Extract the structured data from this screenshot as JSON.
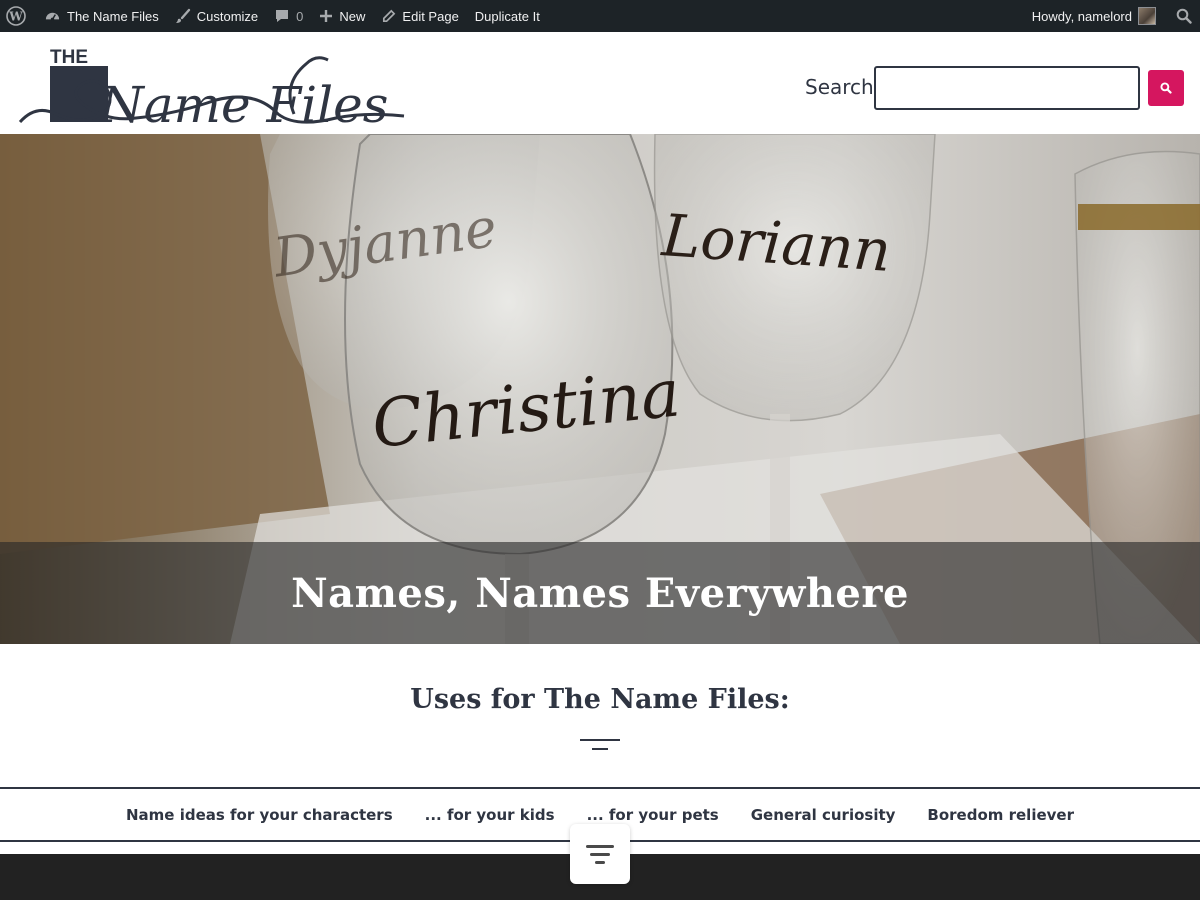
{
  "adminbar": {
    "site_name": "The Name Files",
    "customize": "Customize",
    "comments_count": "0",
    "new_label": "New",
    "edit_page": "Edit Page",
    "duplicate": "Duplicate It",
    "howdy": "Howdy, namelord",
    "icons": [
      "wordpress-icon",
      "dashboard-icon",
      "brush-icon",
      "comment-icon",
      "plus-icon",
      "pencil-icon",
      "search-icon"
    ]
  },
  "header": {
    "logo_the": "THE",
    "logo_script": "Name Files",
    "search_label": "Search",
    "search_value": "",
    "accent": "#d5165f",
    "ink": "#2f3542"
  },
  "hero": {
    "title": "Names, Names Everywhere",
    "glass_names": [
      "Christina",
      "Loriann",
      "Dyjanne"
    ]
  },
  "section": {
    "title": "Uses for The Name Files:"
  },
  "uses_nav": {
    "items": [
      "Name ideas for your characters",
      "... for your kids",
      "... for your pets",
      "General curiosity",
      "Boredom reliever"
    ]
  }
}
